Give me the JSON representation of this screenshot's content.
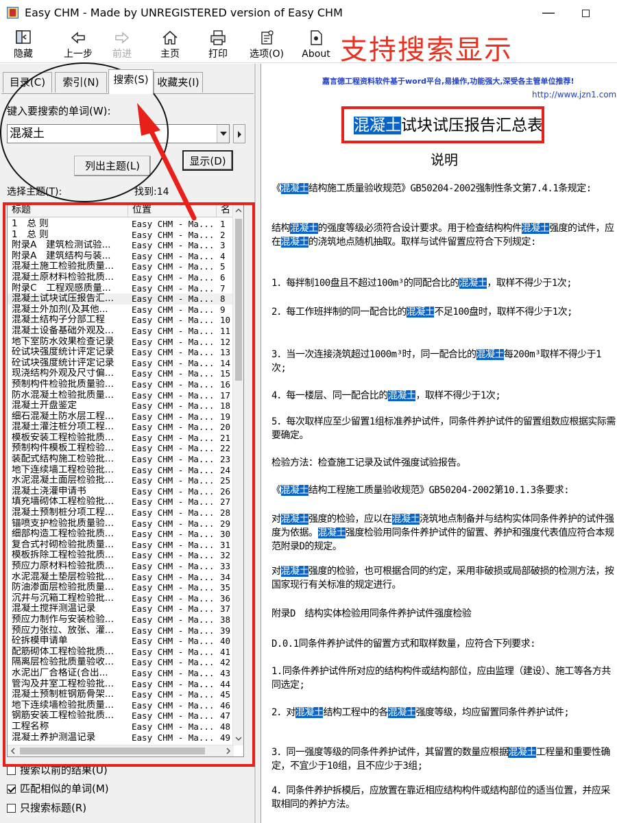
{
  "window": {
    "title": "Easy CHM - Made by UNREGISTERED version of Easy CHM",
    "minimize": "—"
  },
  "toolbar": {
    "hide": "隐藏",
    "back": "上一步",
    "forward": "前进",
    "home": "主页",
    "print": "打印",
    "options": "选项(O)",
    "about": "About"
  },
  "banner": "支持搜索显示",
  "tabs": {
    "contents": "目录(C)",
    "index": "索引(N)",
    "search": "搜索(S)",
    "favorites": "收藏夹(I)"
  },
  "search": {
    "prompt": "键入要搜索的单词(W):",
    "query": "混凝土",
    "list_topics_button": "列出主题(L)",
    "display_button": "显示(D)",
    "select_topic_label": "选择主题(T):",
    "found_label": "找到:14"
  },
  "results": {
    "headers": {
      "title": "标题",
      "location": "位置",
      "rank": "名"
    },
    "selected_index": 7,
    "rows": [
      [
        "1　总 则",
        "Easy CHM - Ma...",
        "1"
      ],
      [
        "1　总 则",
        "Easy CHM - Ma...",
        "2"
      ],
      [
        "附录A　建筑检测试验...",
        "Easy CHM - Ma...",
        "3"
      ],
      [
        "附录A　建筑结构与装...",
        "Easy CHM - Ma...",
        "4"
      ],
      [
        "混凝土施工检验批质量...",
        "Easy CHM - Ma...",
        "5"
      ],
      [
        "混凝土原材料检验批质...",
        "Easy CHM - Ma...",
        "6"
      ],
      [
        "附录C　工程观感质量...",
        "Easy CHM - Ma...",
        "7"
      ],
      [
        "混凝土试块试压报告汇...",
        "Easy CHM - Ma...",
        "8"
      ],
      [
        "混凝土外加剂(及其他...",
        "Easy CHM - Ma...",
        "9"
      ],
      [
        "混凝土结构子分部工程",
        "Easy CHM - Ma...",
        "10"
      ],
      [
        "混凝土设备基础外观及...",
        "Easy CHM - Ma...",
        "11"
      ],
      [
        "地下室防水效果检查记录",
        "Easy CHM - Ma...",
        "12"
      ],
      [
        "砼试块强度统计评定记录",
        "Easy CHM - Ma...",
        "13"
      ],
      [
        "砼试块强度统计评定记录",
        "Easy CHM - Ma...",
        "14"
      ],
      [
        "现浇结构外观及尺寸偏...",
        "Easy CHM - Ma...",
        "15"
      ],
      [
        "预制构件检验批质量验...",
        "Easy CHM - Ma...",
        "16"
      ],
      [
        "防水混凝土检验批质量...",
        "Easy CHM - Ma...",
        "17"
      ],
      [
        "混凝土开盘鉴定",
        "Easy CHM - Ma...",
        "18"
      ],
      [
        "细石混凝土防水层工程...",
        "Easy CHM - Ma...",
        "19"
      ],
      [
        "混凝土灌注桩分项工程...",
        "Easy CHM - Ma...",
        "20"
      ],
      [
        "模板安装工程检验批质...",
        "Easy CHM - Ma...",
        "21"
      ],
      [
        "预制构件模板工程检验...",
        "Easy CHM - Ma...",
        "22"
      ],
      [
        "装配式结构施工检验批...",
        "Easy CHM - Ma...",
        "23"
      ],
      [
        "地下连续墙工程检验批...",
        "Easy CHM - Ma...",
        "24"
      ],
      [
        "水泥混凝土面层检验批...",
        "Easy CHM - Ma...",
        "25"
      ],
      [
        "混凝土浇灌申请书",
        "Easy CHM - Ma...",
        "26"
      ],
      [
        "填充墙砌体工程检验批...",
        "Easy CHM - Ma...",
        "27"
      ],
      [
        "混凝土预制桩分项工程...",
        "Easy CHM - Ma...",
        "28"
      ],
      [
        "锚喷支护检验批质量验...",
        "Easy CHM - Ma...",
        "29"
      ],
      [
        "细部构造工程检验批质...",
        "Easy CHM - Ma...",
        "30"
      ],
      [
        "复合式衬砌检验批质量...",
        "Easy CHM - Ma...",
        "31"
      ],
      [
        "模板拆除工程检验批质...",
        "Easy CHM - Ma...",
        "32"
      ],
      [
        "预应力原材料检验批质...",
        "Easy CHM - Ma...",
        "33"
      ],
      [
        "水泥混凝土垫层检验批...",
        "Easy CHM - Ma...",
        "34"
      ],
      [
        "防油渗面层检验批质量...",
        "Easy CHM - Ma...",
        "35"
      ],
      [
        "沉井与沉箱工程检验批...",
        "Easy CHM - Ma...",
        "36"
      ],
      [
        "混凝土搅拌测温记录",
        "Easy CHM - Ma...",
        "37"
      ],
      [
        "预应力制作与安装检验...",
        "Easy CHM - Ma...",
        "38"
      ],
      [
        "预应力张拉、放张、灌...",
        "Easy CHM - Ma...",
        "39"
      ],
      [
        "砼拆模申请单",
        "Easy CHM - Ma...",
        "40"
      ],
      [
        "配筋砌体工程检验批质...",
        "Easy CHM - Ma...",
        "41"
      ],
      [
        "隔离层检验批质量验收...",
        "Easy CHM - Ma...",
        "42"
      ],
      [
        "水泥出厂合格证(合出...",
        "Easy CHM - Ma...",
        "43"
      ],
      [
        "管沟及井室工程检验批...",
        "Easy CHM - Ma...",
        "44"
      ],
      [
        "混凝土预制桩钢筋骨架...",
        "Easy CHM - Ma...",
        "45"
      ],
      [
        "地下连续墙检验批质量...",
        "Easy CHM - Ma...",
        "46"
      ],
      [
        "钢筋安装工程检验批质...",
        "Easy CHM - Ma...",
        "47"
      ],
      [
        "工程名称",
        "Easy CHM - Ma...",
        "48"
      ],
      [
        "混凝土养护测温记录",
        "Easy CHM - Ma...",
        "49"
      ]
    ]
  },
  "options": {
    "search_previous": "搜索以前的结果(U)",
    "match_similar": "匹配相似的单词(M)",
    "titles_only": "只搜索标题(R)",
    "search_previous_checked": false,
    "match_similar_checked": true,
    "titles_only_checked": false
  },
  "document": {
    "ad_line": "嘉言德工程资料软件基于word平台,易操作,功能强大,深受各主管单位推荐!",
    "ad_url": "http://www.jzn1.com",
    "title_highlight": "混凝土",
    "title_rest": "试块试压报告汇总表",
    "subtitle": "说明",
    "highlight_color": "#0a64c8",
    "paragraphs": [
      [
        {
          "t": "《"
        },
        {
          "t": "混凝土",
          "h": 1
        },
        {
          "t": "结构施工质量验收规范》GB50204-2002强制性条文第7.4.1条规定:"
        }
      ],
      [
        {
          "t": "结构"
        },
        {
          "t": "混凝土",
          "h": 1
        },
        {
          "t": "的强度等级必须符合设计要求。用于检查结构构件"
        },
        {
          "t": "混凝土",
          "h": 1
        },
        {
          "t": "强度的试件，应在"
        },
        {
          "t": "混凝土",
          "h": 1
        },
        {
          "t": "的浇筑地点随机抽取。取样与试件留置应符合下列规定:"
        }
      ],
      [
        {
          "t": "1．每拌制100盘且不超过100m³的同配合比的"
        },
        {
          "t": "混凝土",
          "h": 1
        },
        {
          "t": "，取样不得少于1次;"
        }
      ],
      [
        {
          "t": "2．每工作班拌制的同一配合比的"
        },
        {
          "t": "混凝土",
          "h": 1
        },
        {
          "t": "不足100盘时，取样不得少于1次;"
        }
      ],
      [
        {
          "t": "3．当一次连接浇筑超过1000m³时，同一配合比的"
        },
        {
          "t": "混凝土",
          "h": 1
        },
        {
          "t": "每200m³取样不得少于1次;"
        }
      ],
      [
        {
          "t": "4．每一楼层、同一配合比的"
        },
        {
          "t": "混凝土",
          "h": 1
        },
        {
          "t": "，取样不得少于1次;"
        }
      ],
      [
        {
          "t": "5．每次取样应至少留置1组标准养护试件，同条件养护试件的留置组数应根据实际需要确定。"
        }
      ],
      [
        {
          "t": "检验方法：检查施工记录及试件强度试验报告。"
        }
      ],
      [
        {
          "t": "《"
        },
        {
          "t": "混凝土",
          "h": 1
        },
        {
          "t": "结构工程施工质量验收规范》GB50204-2002第10.1.3条要求:"
        }
      ],
      [
        {
          "t": "对"
        },
        {
          "t": "混凝土",
          "h": 1
        },
        {
          "t": "强度的检验，应以在"
        },
        {
          "t": "混凝土",
          "h": 1
        },
        {
          "t": "浇筑地点制备并与结构实体同条件养护的试件强度为依据。"
        },
        {
          "t": "混凝土",
          "h": 1
        },
        {
          "t": "强度检验用同条件养护试件的留置、养护和强度代表值应符合本规范附录D的规定。"
        }
      ],
      [
        {
          "t": "对"
        },
        {
          "t": "混凝土",
          "h": 1
        },
        {
          "t": "强度的检验，也可根据合同的约定，采用非破损或局部破损的检测方法，按国家现行有关标准的规定进行。"
        }
      ],
      [
        {
          "t": "附录D　结构实体检验用同条件养护试件强度检验"
        }
      ],
      [
        {
          "t": "D.0.1同条件养护试件的留置方式和取样数量，应符合下列要求:"
        }
      ],
      [
        {
          "t": "1.同条件养护试件所对应的结构构件或结构部位，应由监理（建设）、施工等各方共同选定;"
        }
      ],
      [
        {
          "t": "2．对"
        },
        {
          "t": "混凝土",
          "h": 1
        },
        {
          "t": "结构工程中的各"
        },
        {
          "t": "混凝土",
          "h": 1
        },
        {
          "t": "强度等级，均应留置同条件养护试件;"
        }
      ],
      [
        {
          "t": "3．同一强度等级的同条件养护试件，其留置的数量应根据"
        },
        {
          "t": "混凝土",
          "h": 1
        },
        {
          "t": "工程量和重要性确定，不宜少于10组，且不应少于3组;"
        }
      ],
      [
        {
          "t": "4．同条件养护拆模后，应放置在靠近相应结构构件或结构部位的适当位置，并应采取相同的养护方法。"
        }
      ]
    ]
  }
}
